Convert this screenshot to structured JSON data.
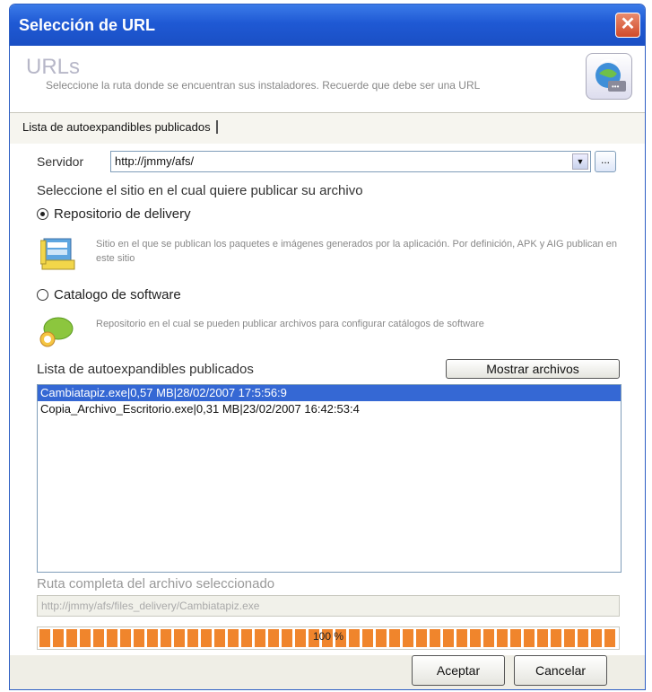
{
  "window": {
    "title": "Selección de URL"
  },
  "header": {
    "title": "URLs",
    "description": "Seleccione la ruta donde se encuentran sus instaladores. Recuerde que debe ser una URL"
  },
  "tabs": [
    {
      "label": "Lista de autoexpandibles publicados"
    }
  ],
  "server": {
    "label": "Servidor",
    "value": "http://jmmy/afs/"
  },
  "site_prompt": "Seleccione el sitio en el cual quiere publicar su archivo",
  "options": [
    {
      "label": "Repositorio de delivery",
      "selected": true,
      "description": "Sitio en el que se publican los paquetes e imágenes generados por la aplicación. Por definición, APK y AIG publican en este sitio"
    },
    {
      "label": "Catalogo de software",
      "selected": false,
      "description": "Repositorio en el cual se pueden publicar archivos para configurar catálogos de software"
    }
  ],
  "published": {
    "label": "Lista de autoexpandibles publicados",
    "show_button": "Mostrar archivos",
    "items": [
      {
        "text": "Cambiatapiz.exe|0,57 MB|28/02/2007 17:5:56:9",
        "selected": true
      },
      {
        "text": "Copia_Archivo_Escritorio.exe|0,31 MB|23/02/2007 16:42:53:4",
        "selected": false
      }
    ]
  },
  "full_path": {
    "label": "Ruta completa del archivo seleccionado",
    "value": "http://jmmy/afs/files_delivery/Cambiatapiz.exe"
  },
  "progress": {
    "percent": 100,
    "label": "100 %"
  },
  "buttons": {
    "accept": "Aceptar",
    "cancel": "Cancelar"
  },
  "colors": {
    "titlebar": "#1f59d4",
    "selection": "#3568d4",
    "progress": "#f0852c",
    "close": "#d14b2a"
  },
  "icons": {
    "header": "url-web-icon",
    "delivery": "delivery-repository-icon",
    "catalog": "software-catalog-icon"
  }
}
